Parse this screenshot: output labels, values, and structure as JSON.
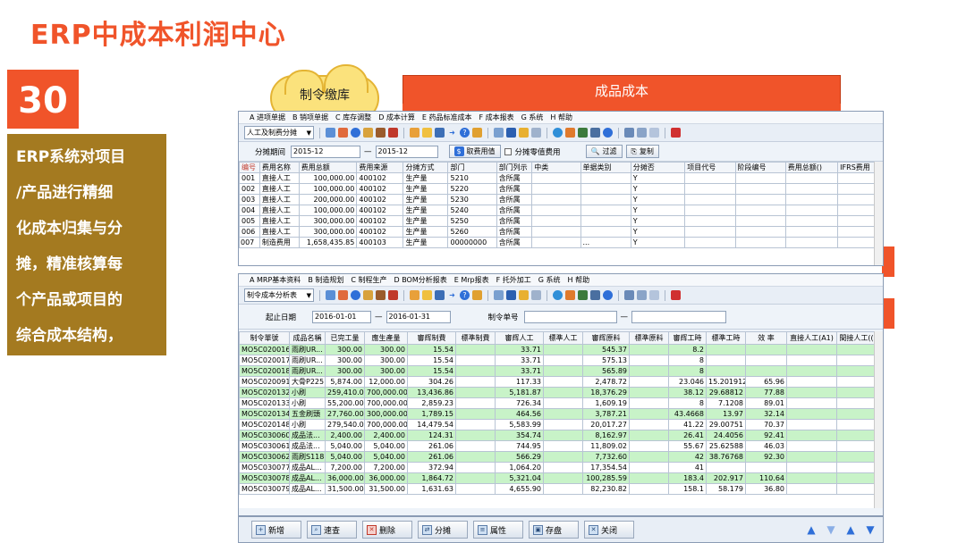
{
  "slide": {
    "title": "ERP中成本利润中心",
    "number": "30",
    "description_lines": [
      "ERP系统对项目",
      "/产品进行精细",
      "化成本归集与分",
      "摊，精准核算每",
      "个产品或项目的",
      "综合成本结构，"
    ],
    "cloud_label": "制令缴库",
    "orange_box_label": "成品成本",
    "colors": {
      "accent": "#f0542a",
      "desc_bg": "#a47a20",
      "row_green": "#c8f3c8"
    }
  },
  "win1": {
    "menu": [
      "A 进项单据",
      "B 销项单据",
      "C 库存调整",
      "D 成本计算",
      "E 药品标准成本",
      "F 成本报表",
      "G 系统",
      "H 帮助"
    ],
    "toolbar_select": "人工及制费分摊",
    "filter": {
      "label": "分摊期间",
      "from": "2015-12",
      "to": "2015-12",
      "btn_fetch": "取费用值",
      "chk_label": "分摊零值费用",
      "btn_filter": "过滤",
      "btn_copy": "复制"
    },
    "columns": [
      "编号",
      "费用名称",
      "费用总额",
      "费用来源",
      "分摊方式",
      "部门",
      "部门列示",
      "中类",
      "单据类别",
      "分摊否",
      "项目代号",
      "阶段编号",
      "费用总额()",
      "IFRS费用"
    ],
    "rows": [
      [
        "001",
        "直接人工",
        "100,000.00",
        "400102",
        "生产量",
        "5210",
        "含所属",
        "",
        "",
        "Y",
        "",
        "",
        "",
        ""
      ],
      [
        "002",
        "直接人工",
        "100,000.00",
        "400102",
        "生产量",
        "5220",
        "含所属",
        "",
        "",
        "Y",
        "",
        "",
        "",
        ""
      ],
      [
        "003",
        "直接人工",
        "200,000.00",
        "400102",
        "生产量",
        "5230",
        "含所属",
        "",
        "",
        "Y",
        "",
        "",
        "",
        ""
      ],
      [
        "004",
        "直接人工",
        "100,000.00",
        "400102",
        "生产量",
        "5240",
        "含所属",
        "",
        "",
        "Y",
        "",
        "",
        "",
        ""
      ],
      [
        "005",
        "直接人工",
        "300,000.00",
        "400102",
        "生产量",
        "5250",
        "含所属",
        "",
        "",
        "Y",
        "",
        "",
        "",
        ""
      ],
      [
        "006",
        "直接人工",
        "300,000.00",
        "400102",
        "生产量",
        "5260",
        "含所属",
        "",
        "",
        "Y",
        "",
        "",
        "",
        ""
      ],
      [
        "007",
        "制造费用",
        "1,658,435.85",
        "400103",
        "生产量",
        "00000000",
        "含所属",
        "",
        "...",
        "Y",
        "",
        "",
        "",
        ""
      ]
    ]
  },
  "win2": {
    "menu": [
      "A MRP基本资料",
      "B 制造规划",
      "C 制程生产",
      "D BOM分析报表",
      "E Mrp报表",
      "F 托外加工",
      "G 系统",
      "H 帮助"
    ],
    "toolbar_select": "制令成本分析表",
    "filter": {
      "date_label": "起止日期",
      "from": "2016-01-01",
      "to": "2016-01-31",
      "order_label": "制令单号"
    },
    "columns": [
      "制令單號",
      "成品名稱",
      "已完工量",
      "應生產量",
      "審辉制費",
      "標準制費",
      "審辉人工",
      "標準人工",
      "審辉原料",
      "標準原料",
      "審辉工時",
      "標準工時",
      "效 率",
      "直接人工(A1)",
      "間接人工(("
    ],
    "rows": [
      [
        "MO5C020016",
        "雨刷UR...",
        "300.00",
        "300.00",
        "15.54",
        "",
        "33.71",
        "",
        "545.37",
        "",
        "8.2",
        "",
        "",
        "",
        ""
      ],
      [
        "MO5C020017",
        "雨刷UR...",
        "300.00",
        "300.00",
        "15.54",
        "",
        "33.71",
        "",
        "575.13",
        "",
        "8",
        "",
        "",
        "",
        ""
      ],
      [
        "MO5C020018",
        "雨刷UR...",
        "300.00",
        "300.00",
        "15.54",
        "",
        "33.71",
        "",
        "565.89",
        "",
        "8",
        "",
        "",
        "",
        ""
      ],
      [
        "MO5C020091",
        "大骨P225",
        "5,874.00",
        "12,000.00",
        "304.26",
        "",
        "117.33",
        "",
        "2,478.72",
        "",
        "23.046",
        "15.201912",
        "65.96",
        "",
        ""
      ],
      [
        "MO5C020132",
        "小刷",
        "259,410.00",
        "700,000.00",
        "13,436.86",
        "",
        "5,181.87",
        "",
        "18,376.29",
        "",
        "38.12",
        "29.68812",
        "77.88",
        "",
        ""
      ],
      [
        "MO5C020133",
        "小刷",
        "55,200.00",
        "700,000.00",
        "2,859.23",
        "",
        "726.34",
        "",
        "1,609.19",
        "",
        "8",
        "7.1208",
        "89.01",
        "",
        ""
      ],
      [
        "MO5C020134",
        "五金刷頭",
        "27,760.00",
        "300,000.00",
        "1,789.15",
        "",
        "464.56",
        "",
        "3,787.21",
        "",
        "43.4668",
        "13.97",
        "32.14",
        "",
        ""
      ],
      [
        "MO5C020148",
        "小刷",
        "279,540.00",
        "700,000.00",
        "14,479.54",
        "",
        "5,583.99",
        "",
        "20,017.27",
        "",
        "41.22",
        "29.00751",
        "70.37",
        "",
        ""
      ],
      [
        "MO5C030060",
        "成品法...",
        "2,400.00",
        "2,400.00",
        "124.31",
        "",
        "354.74",
        "",
        "8,162.97",
        "",
        "26.41",
        "24.4056",
        "92.41",
        "",
        ""
      ],
      [
        "MO5C030061",
        "成品法...",
        "5,040.00",
        "5,040.00",
        "261.06",
        "",
        "744.95",
        "",
        "11,809.02",
        "",
        "55.67",
        "25.62588",
        "46.03",
        "",
        ""
      ],
      [
        "MO5C030062",
        "雨刷S118",
        "5,040.00",
        "5,040.00",
        "261.06",
        "",
        "566.29",
        "",
        "7,732.60",
        "",
        "42",
        "38.76768",
        "92.30",
        "",
        ""
      ],
      [
        "MO5C030077",
        "成品AL...",
        "7,200.00",
        "7,200.00",
        "372.94",
        "",
        "1,064.20",
        "",
        "17,354.54",
        "",
        "41",
        "",
        "",
        "",
        ""
      ],
      [
        "MO5C030078",
        "成品AL...",
        "36,000.00",
        "36,000.00",
        "1,864.72",
        "",
        "5,321.04",
        "",
        "100,285.59",
        "",
        "183.4",
        "202.917",
        "110.64",
        "",
        ""
      ],
      [
        "MO5C030079",
        "成品AL...",
        "31,500.00",
        "31,500.00",
        "1,631.63",
        "",
        "4,655.90",
        "",
        "82,230.82",
        "",
        "158.1",
        "58.179",
        "36.80",
        "",
        ""
      ]
    ]
  },
  "bottom_buttons": [
    "新增",
    "速查",
    "删除",
    "分摊",
    "属性",
    "存盘",
    "关闭"
  ]
}
